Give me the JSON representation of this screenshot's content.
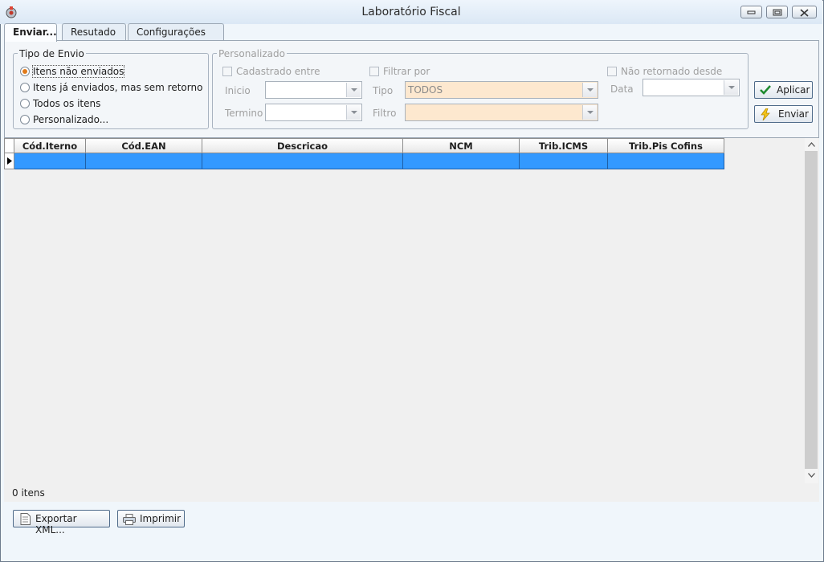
{
  "window": {
    "title": "Laboratório Fiscal",
    "icon": "app-gear-icon",
    "controls": [
      "minimize-icon",
      "restore-icon",
      "close-icon"
    ]
  },
  "tabs": [
    {
      "label": "Enviar...",
      "active": true
    },
    {
      "label": "Resutado",
      "active": false
    },
    {
      "label": "Configurações",
      "active": false
    }
  ],
  "tipo_envio": {
    "legend": "Tipo de Envio",
    "options": [
      {
        "label": "Itens não enviados",
        "selected": true
      },
      {
        "label": "Itens já enviados, mas sem retorno",
        "selected": false
      },
      {
        "label": "Todos os itens",
        "selected": false
      },
      {
        "label": "Personalizado...",
        "selected": false
      }
    ]
  },
  "personalizado": {
    "legend": "Personalizado",
    "cadastrado_entre": "Cadastrado entre",
    "inicio_label": "Inicio",
    "termino_label": "Termino",
    "filtrar_por": "Filtrar por",
    "tipo_label": "Tipo",
    "tipo_value": "TODOS",
    "filtro_label": "Filtro",
    "nao_retornado": "Não retornado desde",
    "data_label": "Data"
  },
  "actions": {
    "aplicar": "Aplicar",
    "enviar": "Enviar"
  },
  "grid": {
    "columns": [
      "Cód.Iterno",
      "Cód.EAN",
      "Descricao",
      "NCM",
      "Trib.ICMS",
      "Trib.Pis Cofins"
    ],
    "status": "0 itens"
  },
  "footer": {
    "exportar": "Exportar XML...",
    "imprimir": "Imprimir"
  },
  "colors": {
    "selection": "#3399ff",
    "radio_dot": "#e07a1a",
    "tipo_field_bg": "#fde8cf"
  }
}
